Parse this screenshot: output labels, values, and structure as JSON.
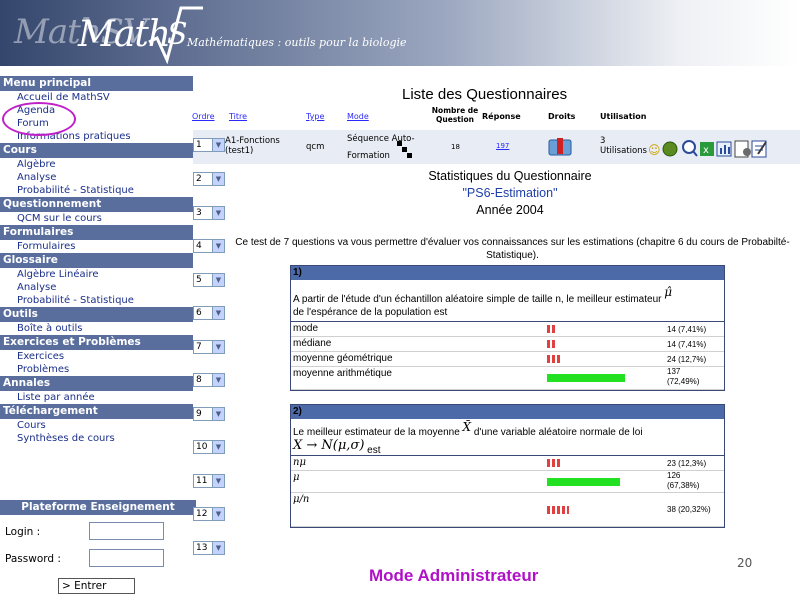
{
  "banner": {
    "logo_faded": "MathSV",
    "logo": "Math",
    "tagline": "Mathématiques : outils pour la biologie"
  },
  "sidebar": {
    "sections": [
      {
        "title": "Menu principal",
        "items": [
          "Accueil de MathSV",
          "Agenda",
          "Forum",
          "Informations pratiques"
        ]
      },
      {
        "title": "Cours",
        "items": [
          "Algèbre",
          "Analyse",
          "Probabilité - Statistique"
        ]
      },
      {
        "title": "Questionnement",
        "items": [
          "QCM sur le cours"
        ]
      },
      {
        "title": "Formulaires",
        "items": [
          "Formulaires"
        ]
      },
      {
        "title": "Glossaire",
        "items": [
          "Algèbre Linéaire",
          "Analyse",
          "Probabilité - Statistique"
        ]
      },
      {
        "title": "Outils",
        "items": [
          "Boîte à outils"
        ]
      },
      {
        "title": "Exercices et Problèmes",
        "items": [
          "Exercices",
          "Problèmes"
        ]
      },
      {
        "title": "Annales",
        "items": [
          "Liste par année"
        ]
      },
      {
        "title": "Téléchargement",
        "items": [
          "Cours",
          "Synthèses de cours"
        ]
      }
    ]
  },
  "login": {
    "title": "Plateforme Enseignement",
    "login_label": "Login :",
    "password_label": "Password :",
    "enter_label": "> Entrer"
  },
  "list": {
    "title": "Liste des Questionnaires",
    "headers": {
      "ordre": "Ordre",
      "titre": "Titre",
      "type": "Type",
      "mode": "Mode",
      "nb_q": "Nombre de Question",
      "reponse": "Réponse",
      "droits": "Droits",
      "utilisation": "Utilisation"
    },
    "row1": {
      "ordre": "1",
      "titre": "A1-Fonctions (test1)",
      "type": "qcm",
      "mode": "Séquence Auto-Formation",
      "nb_q": "18",
      "reponse": "197",
      "utilisation": "3 Utilisations"
    },
    "orders": [
      "2",
      "3",
      "4",
      "5",
      "6",
      "7",
      "8",
      "9",
      "10",
      "11",
      "12",
      "13"
    ]
  },
  "stats": {
    "line1": "Statistiques du Questionnaire",
    "line2": "\"PS6-Estimation\"",
    "line3": "Année 2004",
    "intro": "Ce test de 7 questions va vous permettre d'évaluer vos connaissances sur les estimations (chapitre 6 du cours de Probabilté-Statistique)."
  },
  "q1": {
    "num": "1)",
    "text": "A partir de l'étude d'un échantillon aléatoire simple de taille n, le meilleur estimateur",
    "text2": "de l'espérance de la population est",
    "symbol": "μ̂",
    "answers": [
      {
        "label": "mode",
        "count": "14",
        "pct": "(7,41%)",
        "fraction": 0.0741
      },
      {
        "label": "médiane",
        "count": "14",
        "pct": "(7,41%)",
        "fraction": 0.0741
      },
      {
        "label": "moyenne géométrique",
        "count": "24",
        "pct": "(12,7%)",
        "fraction": 0.127
      },
      {
        "label": "moyenne arithmétique",
        "count": "137",
        "pct": "(72,49%)",
        "fraction": 0.7249
      }
    ]
  },
  "q2": {
    "num": "2)",
    "text": "Le meilleur estimateur de la moyenne",
    "symbol": "X̄",
    "text_b": "d'une variable aléatoire normale de loi",
    "formula": "X → N(μ,σ)",
    "text_c": "est",
    "answers": [
      {
        "label": "nμ",
        "count": "23",
        "pct": "(12,3%)",
        "fraction": 0.123
      },
      {
        "label": "μ",
        "count": "126",
        "pct": "(67,38%)",
        "fraction": 0.6738
      },
      {
        "label": "μ/n",
        "count": "38",
        "pct": "(20,32%)",
        "fraction": 0.2032
      }
    ]
  },
  "footer": {
    "mode_admin": "Mode Administrateur",
    "page_num": "20"
  }
}
